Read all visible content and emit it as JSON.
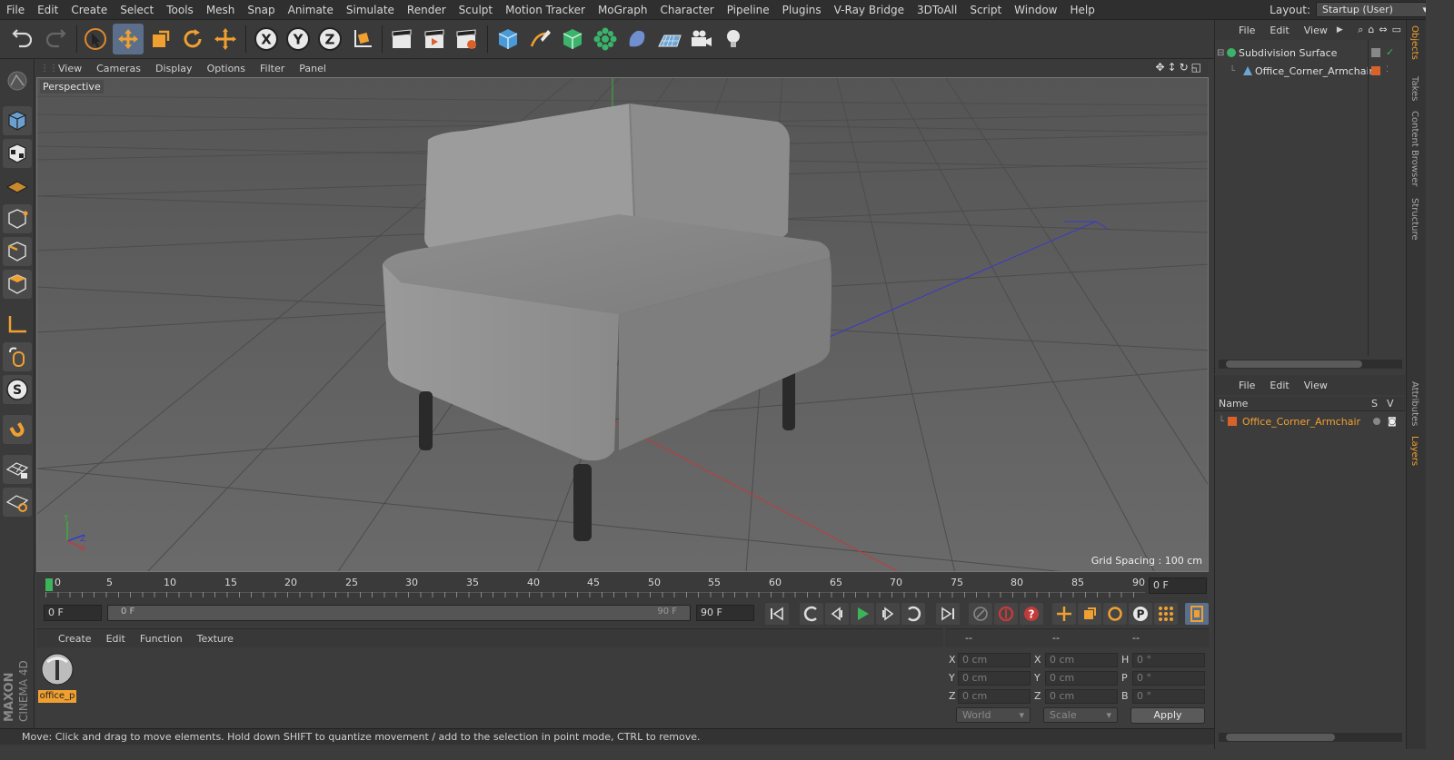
{
  "menubar": {
    "items": [
      "File",
      "Edit",
      "Create",
      "Select",
      "Tools",
      "Mesh",
      "Snap",
      "Animate",
      "Simulate",
      "Render",
      "Sculpt",
      "Motion Tracker",
      "MoGraph",
      "Character",
      "Pipeline",
      "Plugins",
      "V-Ray Bridge",
      "3DToAll",
      "Script",
      "Window",
      "Help"
    ],
    "layout_label": "Layout:",
    "layout_value": "Startup (User)"
  },
  "viewport": {
    "menu": [
      "View",
      "Cameras",
      "Display",
      "Options",
      "Filter",
      "Panel"
    ],
    "camera_label": "Perspective",
    "grid_spacing": "Grid Spacing : 100 cm",
    "axis_labels": {
      "y": "Y",
      "z": "Z",
      "x": "X"
    }
  },
  "timeline": {
    "ticks": [
      "0",
      "5",
      "10",
      "15",
      "20",
      "25",
      "30",
      "35",
      "40",
      "45",
      "50",
      "55",
      "60",
      "65",
      "70",
      "75",
      "80",
      "85",
      "90"
    ],
    "current_frame_right": "0 F",
    "start_field": "0 F",
    "range_left": "0 F",
    "range_right": "90 F",
    "end_field": "90 F"
  },
  "material_manager": {
    "menu": [
      "Create",
      "Edit",
      "Function",
      "Texture"
    ],
    "material_name": "office_p"
  },
  "coordinates": {
    "headers": [
      "--",
      "--",
      "--"
    ],
    "rows": [
      {
        "a": "X",
        "av": "0 cm",
        "b": "X",
        "bv": "0 cm",
        "c": "H",
        "cv": "0 °"
      },
      {
        "a": "Y",
        "av": "0 cm",
        "b": "Y",
        "bv": "0 cm",
        "c": "P",
        "cv": "0 °"
      },
      {
        "a": "Z",
        "av": "0 cm",
        "b": "Z",
        "bv": "0 cm",
        "c": "B",
        "cv": "0 °"
      }
    ],
    "mode_world": "World",
    "mode_scale": "Scale",
    "apply": "Apply"
  },
  "status_text": "Move: Click and drag to move elements. Hold down SHIFT to quantize movement / add to the selection in point mode, CTRL to remove.",
  "object_manager": {
    "menu": [
      "File",
      "Edit",
      "View"
    ],
    "objects": [
      {
        "name": "Subdivision Surface"
      },
      {
        "name": "Office_Corner_Armchair"
      }
    ]
  },
  "layer_manager": {
    "menu": [
      "File",
      "Edit",
      "View"
    ],
    "col_name": "Name",
    "col_s": "S",
    "col_v": "V",
    "layer_name": "Office_Corner_Armchair"
  },
  "side_tabs": [
    "Objects",
    "Takes",
    "Content Browser",
    "Structure",
    "Attributes",
    "Layers"
  ],
  "branding": {
    "line1": "MAXON",
    "line2": "CINEMA 4D"
  },
  "colors": {
    "accent": "#f0a030",
    "layer_color": "#d9622b",
    "selected_blue": "#5b6f8a"
  }
}
